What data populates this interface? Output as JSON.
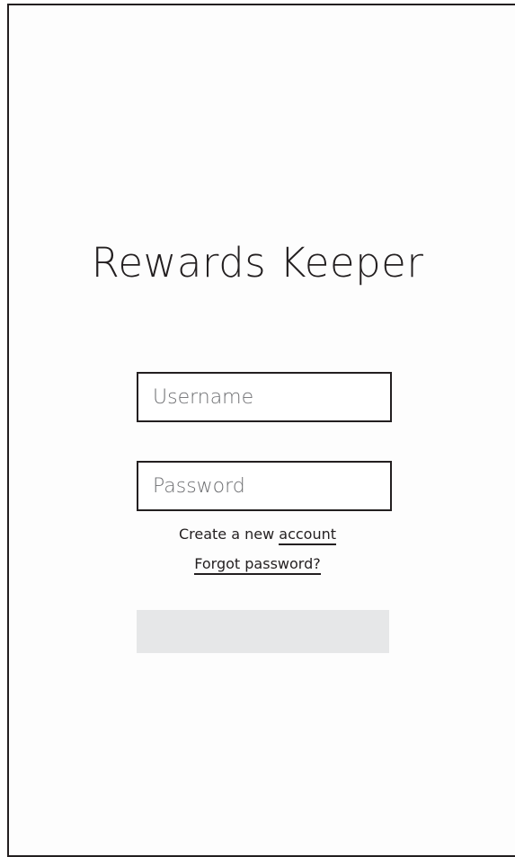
{
  "app": {
    "title": "Rewards Keeper"
  },
  "login": {
    "username_placeholder": "Username",
    "password_placeholder": "Password",
    "create_prefix": "Create a new ",
    "create_link": "account",
    "forgot_link": "Forgot password?",
    "submit_label": ""
  },
  "colors": {
    "ink": "#231f20",
    "placeholder": "#6d6e71",
    "button_fill": "#e6e7e8"
  }
}
